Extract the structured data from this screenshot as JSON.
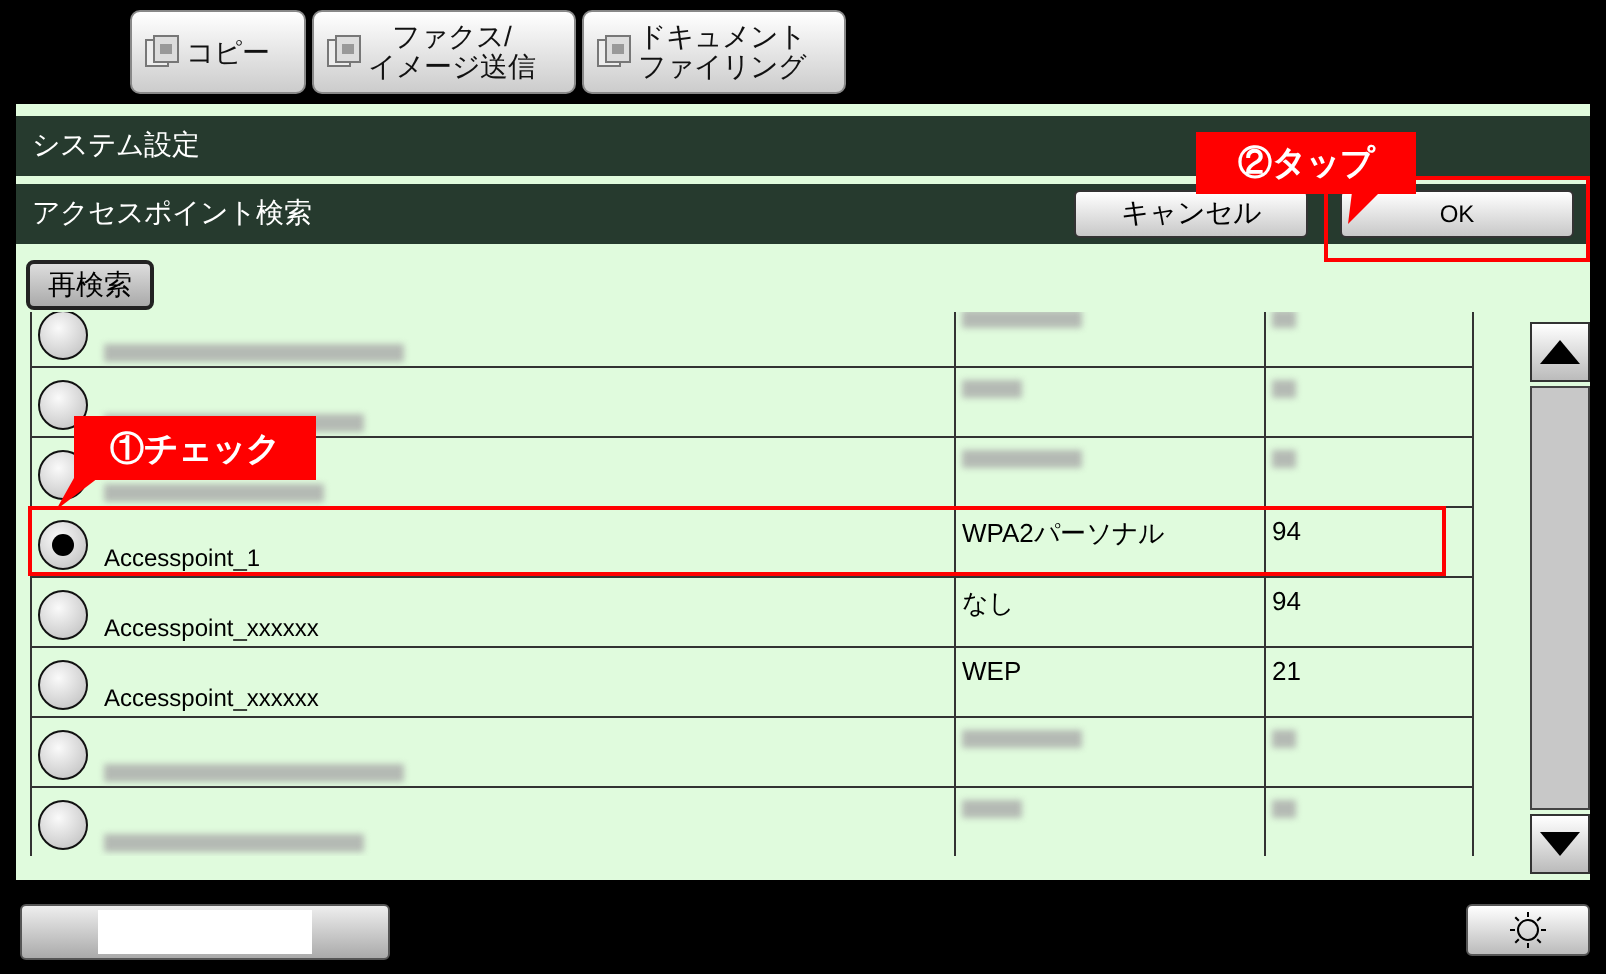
{
  "tabs": [
    {
      "lines": [
        "コピー"
      ]
    },
    {
      "lines": [
        "ファクス/",
        "イメージ送信"
      ]
    },
    {
      "lines": [
        "ドキュメント",
        "ファイリング"
      ]
    }
  ],
  "header": {
    "title": "システム設定",
    "subtitle": "アクセスポイント検索",
    "cancel_button": "キャンセル",
    "ok_button": "OK"
  },
  "rescan_button": "再検索",
  "rows": [
    {
      "kind": "blurred",
      "selected": false
    },
    {
      "kind": "blurred",
      "selected": false
    },
    {
      "kind": "blurred",
      "selected": false
    },
    {
      "kind": "text",
      "name": "Accesspoint_1",
      "security": "WPA2パーソナル",
      "signal": "94",
      "selected": true
    },
    {
      "kind": "text",
      "name": "Accesspoint_xxxxxx",
      "security": "なし",
      "signal": "94",
      "selected": false
    },
    {
      "kind": "text",
      "name": "Accesspoint_xxxxxx",
      "security": "WEP",
      "signal": "21",
      "selected": false
    },
    {
      "kind": "blurred",
      "selected": false
    },
    {
      "kind": "blurred",
      "selected": false
    }
  ],
  "annotations": [
    {
      "text": "②タップ",
      "kind": "button"
    },
    {
      "text": "①チェック",
      "kind": "row"
    }
  ]
}
